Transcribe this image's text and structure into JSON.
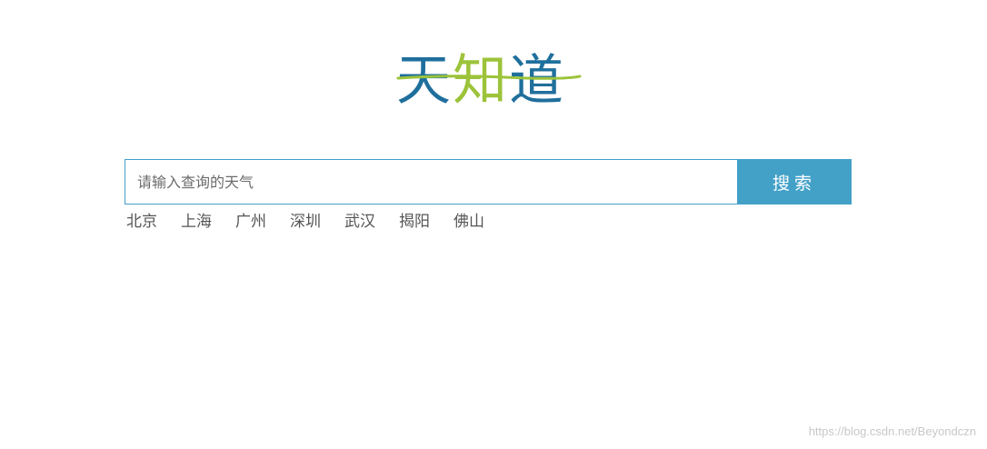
{
  "logo": {
    "part1": "天",
    "part2": "知",
    "part3": "道",
    "colors": {
      "primary": "#1f6f9c",
      "accent": "#9cc33a"
    }
  },
  "search": {
    "placeholder": "请输入查询的天气",
    "value": "",
    "button_label": "搜索",
    "accent_color": "#43a1c8"
  },
  "cities": [
    "北京",
    "上海",
    "广州",
    "深圳",
    "武汉",
    "揭阳",
    "佛山"
  ],
  "watermark": "https://blog.csdn.net/Beyondczn"
}
